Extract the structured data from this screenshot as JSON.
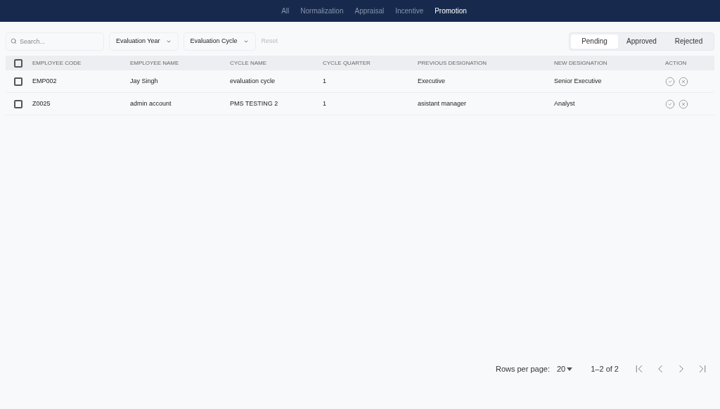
{
  "nav_tabs": [
    {
      "label": "All",
      "selected": false
    },
    {
      "label": "Normalization",
      "selected": false
    },
    {
      "label": "Appraisal",
      "selected": false
    },
    {
      "label": "Incentive",
      "selected": false
    },
    {
      "label": "Promotion",
      "selected": true
    }
  ],
  "filters": {
    "search_placeholder": "Search...",
    "dropdowns": [
      "Evaluation Year",
      "Evaluation Cycle"
    ],
    "reset": "Reset"
  },
  "status_tabs": [
    {
      "label": "Pending",
      "selected": true
    },
    {
      "label": "Approved",
      "selected": false
    },
    {
      "label": "Rejected",
      "selected": false
    }
  ],
  "table": {
    "select_all_checked": false,
    "columns": [
      "EMPLOYEE CODE",
      "EMPLOYEE NAME",
      "CYCLE NAME",
      "CYCLE QUARTER",
      "PREVIOUS DESIGNATION",
      "NEW DESIGNATION",
      "ACTION"
    ],
    "rows": [
      {
        "checked": false,
        "cells": [
          "EMP002",
          "Jay Singh",
          "evaluation cycle",
          "1",
          "Executive",
          "Senior Executive"
        ]
      },
      {
        "checked": false,
        "cells": [
          "Z0025",
          "admin account",
          "PMS TESTING 2",
          "1",
          "asistant manager",
          "Analyst"
        ]
      }
    ]
  },
  "pagination": {
    "rows_per_page_label": "Rows per page:",
    "rows_per_page": "20",
    "range": "1–2 of 2"
  }
}
